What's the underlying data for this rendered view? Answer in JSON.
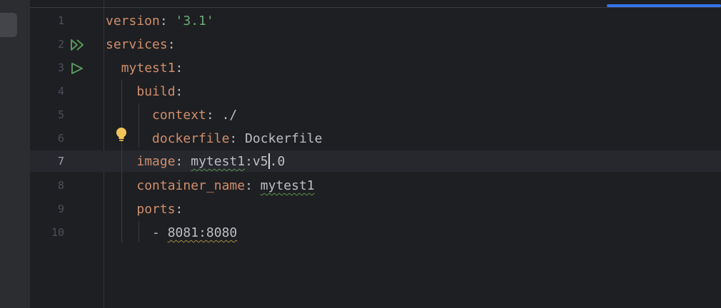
{
  "editor": {
    "lines": [
      {
        "num": "1",
        "indent": "",
        "key": "version",
        "sep": ": ",
        "value": "'3.1'"
      },
      {
        "num": "2",
        "indent": "",
        "key": "services",
        "sep": ":",
        "value": ""
      },
      {
        "num": "3",
        "indent": "  ",
        "key": "mytest1",
        "sep": ":",
        "value": ""
      },
      {
        "num": "4",
        "indent": "    ",
        "key": "build",
        "sep": ":",
        "value": ""
      },
      {
        "num": "5",
        "indent": "      ",
        "key": "context",
        "sep": ": ",
        "value": "./"
      },
      {
        "num": "6",
        "indent": "      ",
        "key": "dockerfile",
        "sep": ": ",
        "value": "Dockerfile"
      },
      {
        "num": "7",
        "indent": "    ",
        "key": "image",
        "sep": ": ",
        "value_a": "mytest1",
        "value_b": ":v5",
        "value_c": ".0"
      },
      {
        "num": "8",
        "indent": "    ",
        "key": "container_name",
        "sep": ": ",
        "value": "mytest1"
      },
      {
        "num": "9",
        "indent": "    ",
        "key": "ports",
        "sep": ":",
        "value": ""
      },
      {
        "num": "10",
        "indent": "      ",
        "dash": "- ",
        "value": "8081:8080"
      }
    ],
    "active_line": "7"
  },
  "gutter_icons": {
    "line2": "run-all-icon",
    "line3": "run-icon",
    "line6": "intention-bulb-icon"
  },
  "colors": {
    "background": "#1e1f22",
    "key": "#cf8e6d",
    "string": "#6aab73",
    "text": "#bcbec4",
    "line_number": "#4b5059",
    "accent": "#3574f0"
  }
}
